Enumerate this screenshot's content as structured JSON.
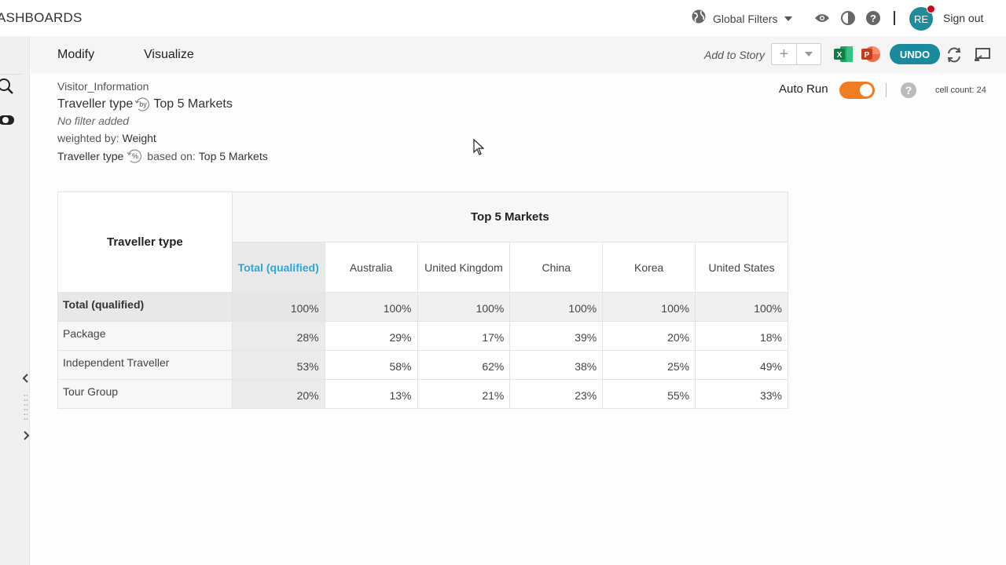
{
  "header": {
    "brand": "ASHBOARDS",
    "global_filters_label": "Global Filters",
    "avatar_initials": "RE",
    "sign_out_label": "Sign out"
  },
  "toolbar": {
    "tabs": [
      "Modify",
      "Visualize"
    ],
    "add_to_story_label": "Add to Story",
    "plus_label": "+",
    "undo_label": "UNDO"
  },
  "info": {
    "dataset": "Visitor_Information",
    "row_var": "Traveller type",
    "col_var": "Top 5 Markets",
    "by_label": "by",
    "filter_text": "No filter added",
    "weighted_prefix": "weighted by:",
    "weight_name": "Weight",
    "percent_var": "Traveller type",
    "percent_label": "%",
    "based_on_prefix": "based on:",
    "based_on_value": "Top 5 Markets"
  },
  "controls": {
    "auto_run_label": "Auto Run",
    "auto_run_on": true,
    "cell_count_label": "cell count: 24"
  },
  "table": {
    "corner_label": "Traveller type",
    "group_label": "Top 5 Markets",
    "columns": [
      "Total (qualified)",
      "Australia",
      "United Kingdom",
      "China",
      "Korea",
      "United States"
    ],
    "rows": [
      {
        "label": "Total (qualified)",
        "values": [
          "100%",
          "100%",
          "100%",
          "100%",
          "100%",
          "100%"
        ]
      },
      {
        "label": "Package",
        "values": [
          "28%",
          "29%",
          "17%",
          "39%",
          "20%",
          "18%"
        ]
      },
      {
        "label": "Independent Traveller",
        "values": [
          "53%",
          "58%",
          "62%",
          "38%",
          "25%",
          "49%"
        ]
      },
      {
        "label": "Tour Group",
        "values": [
          "20%",
          "13%",
          "21%",
          "23%",
          "55%",
          "33%"
        ]
      }
    ]
  },
  "colors": {
    "accent_teal": "#1a8a9c",
    "toggle_orange": "#ef7d22",
    "link_blue": "#2ba7d6",
    "notification_red": "#d0021b"
  }
}
